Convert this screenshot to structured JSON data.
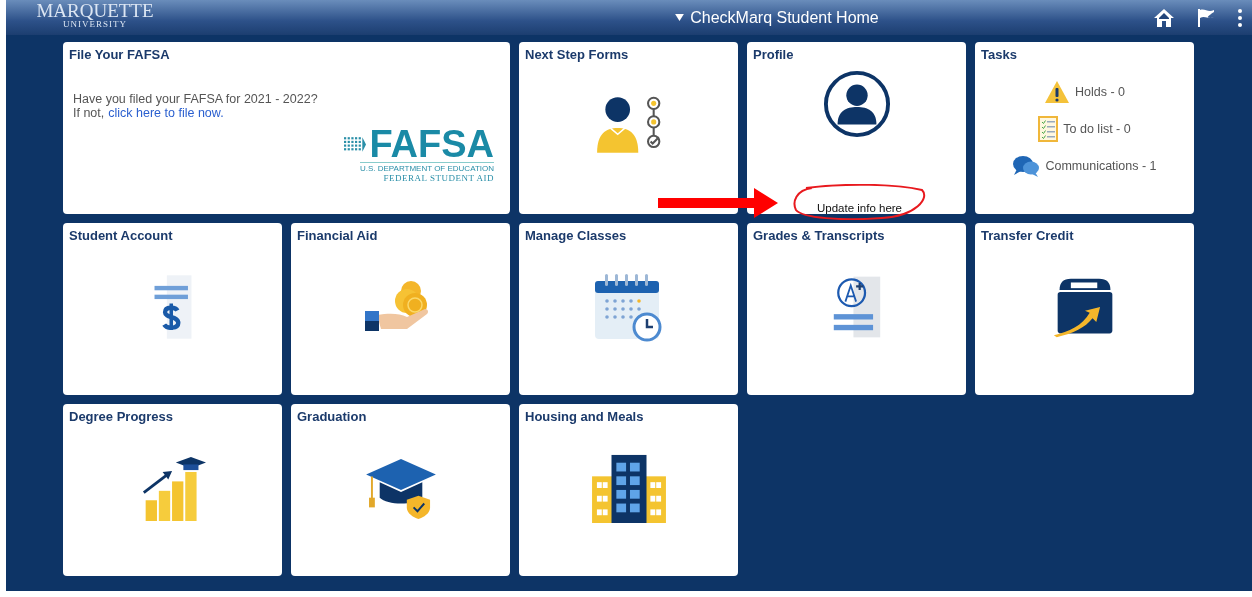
{
  "header": {
    "logo_name": "MARQUETTE",
    "logo_sub": "UNIVERSITY",
    "title": "CheckMarq Student Home"
  },
  "tiles": [
    {
      "kind": "fafsa",
      "title": "File Your FAFSA",
      "question": "Have you filed your FAFSA for 2021 - 2022?",
      "prompt": "If not,",
      "link": "click here to file now.",
      "logo_word": "FAFSA",
      "logo_line1": "U.S. DEPARTMENT OF EDUCATION",
      "logo_line2": "FEDERAL STUDENT AID"
    },
    {
      "kind": "icon",
      "title": "Next Step Forms"
    },
    {
      "kind": "profile",
      "title": "Profile",
      "link": "Update info here"
    },
    {
      "kind": "tasks",
      "title": "Tasks",
      "items": [
        "Holds - 0",
        "To do list - 0",
        "Communications - 1"
      ]
    },
    {
      "kind": "icon",
      "title": "Student Account"
    },
    {
      "kind": "icon",
      "title": "Financial Aid"
    },
    {
      "kind": "icon",
      "title": "Manage Classes"
    },
    {
      "kind": "icon",
      "title": "Grades & Transcripts"
    },
    {
      "kind": "icon",
      "title": "Transfer Credit"
    },
    {
      "kind": "icon",
      "title": "Degree Progress"
    },
    {
      "kind": "icon",
      "title": "Graduation"
    },
    {
      "kind": "icon",
      "title": "Housing and Meals"
    }
  ]
}
